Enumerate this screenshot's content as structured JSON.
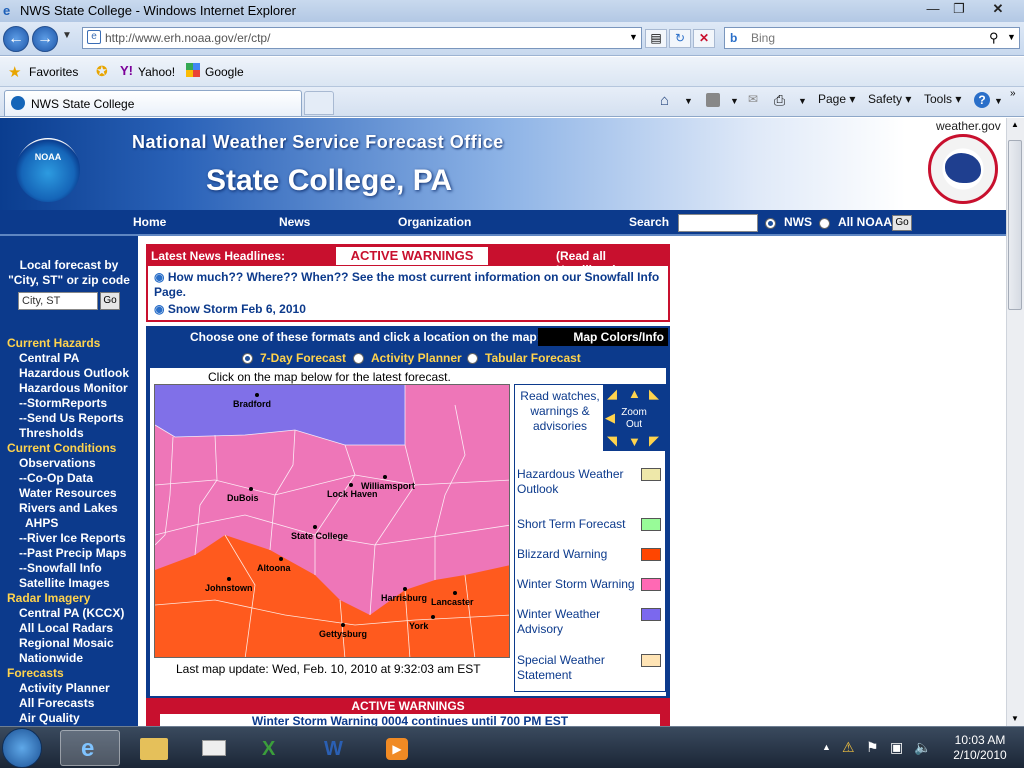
{
  "window": {
    "title": "NWS State College - Windows Internet Explorer",
    "url": "http://www.erh.noaa.gov/er/ctp/",
    "search_placeholder": "Bing",
    "tab_title": "NWS State College"
  },
  "favorites": {
    "label": "Favorites",
    "yahoo": "Yahoo!",
    "google": "Google"
  },
  "commands": {
    "page": "Page",
    "safety": "Safety",
    "tools": "Tools"
  },
  "header": {
    "weather_gov": "weather.gov",
    "office": "National Weather Service Forecast Office",
    "city": "State College, PA",
    "noaa": "NOAA"
  },
  "topnav": {
    "home": "Home",
    "news": "News",
    "organization": "Organization",
    "search": "Search",
    "nws": "NWS",
    "all_noaa": "All NOAA",
    "go": "Go"
  },
  "sidebar": {
    "local_forecast": "Local forecast by",
    "city_zip": "\"City, ST\" or zip code",
    "input_placeholder": "City, ST",
    "go": "Go",
    "links": [
      "Current Hazards",
      "Central PA",
      "Hazardous Outlook",
      "Hazardous Monitor",
      "--StormReports",
      "--Send Us Reports",
      "Thresholds",
      "Current Conditions",
      "Observations",
      "--Co-Op Data",
      "Water Resources",
      "Rivers and Lakes",
      "AHPS",
      "--River Ice Reports",
      "--Past Precip Maps",
      "--Snowfall Info",
      "Satellite Images",
      "Radar Imagery",
      "Central PA (KCCX)",
      "All Local Radars",
      "Regional Mosaic",
      "Nationwide",
      "Forecasts",
      "Activity Planner",
      "All Forecasts",
      "Air Quality"
    ]
  },
  "news": {
    "latest": "Latest News Headlines:",
    "active": "ACTIVE WARNINGS",
    "read_all": "(Read all Headlines)",
    "item1": "How much?? Where?? When?? See the most current information on our Snowfall Info Page.",
    "item2": "Snow Storm Feb 6, 2010"
  },
  "mapsec": {
    "choose": "Choose one of these formats and click a location on the map:",
    "map_colors": "Map Colors/Info",
    "fmt1": "7-Day Forecast",
    "fmt2": "Activity Planner",
    "fmt3": "Tabular Forecast",
    "click": "Click on the map below for the latest forecast.",
    "last_update": "Last map update: Wed, Feb. 10, 2010 at 9:32:03 am EST",
    "read_watches": "Read watches, warnings & advisories",
    "zoom": "Zoom Out"
  },
  "legend": [
    {
      "label": "Hazardous Weather Outlook",
      "color": "#eee8aa"
    },
    {
      "label": "Short Term Forecast",
      "color": "#98fb98"
    },
    {
      "label": "Blizzard Warning",
      "color": "#ff4500"
    },
    {
      "label": "Winter Storm Warning",
      "color": "#ff69b4"
    },
    {
      "label": "Winter Weather Advisory",
      "color": "#7b68ee"
    },
    {
      "label": "Special Weather Statement",
      "color": "#ffe4b5"
    }
  ],
  "cities": [
    "Bradford",
    "Williamsport",
    "DuBois",
    "Lock Haven",
    "State College",
    "Altoona",
    "Johnstown",
    "Harrisburg",
    "Lancaster",
    "York",
    "Gettysburg"
  ],
  "active_warnings": {
    "header": "ACTIVE WARNINGS",
    "line": "Winter Storm Warning 0004 continues until 700 PM EST"
  },
  "clock": {
    "time": "10:03 AM",
    "date": "2/10/2010"
  }
}
